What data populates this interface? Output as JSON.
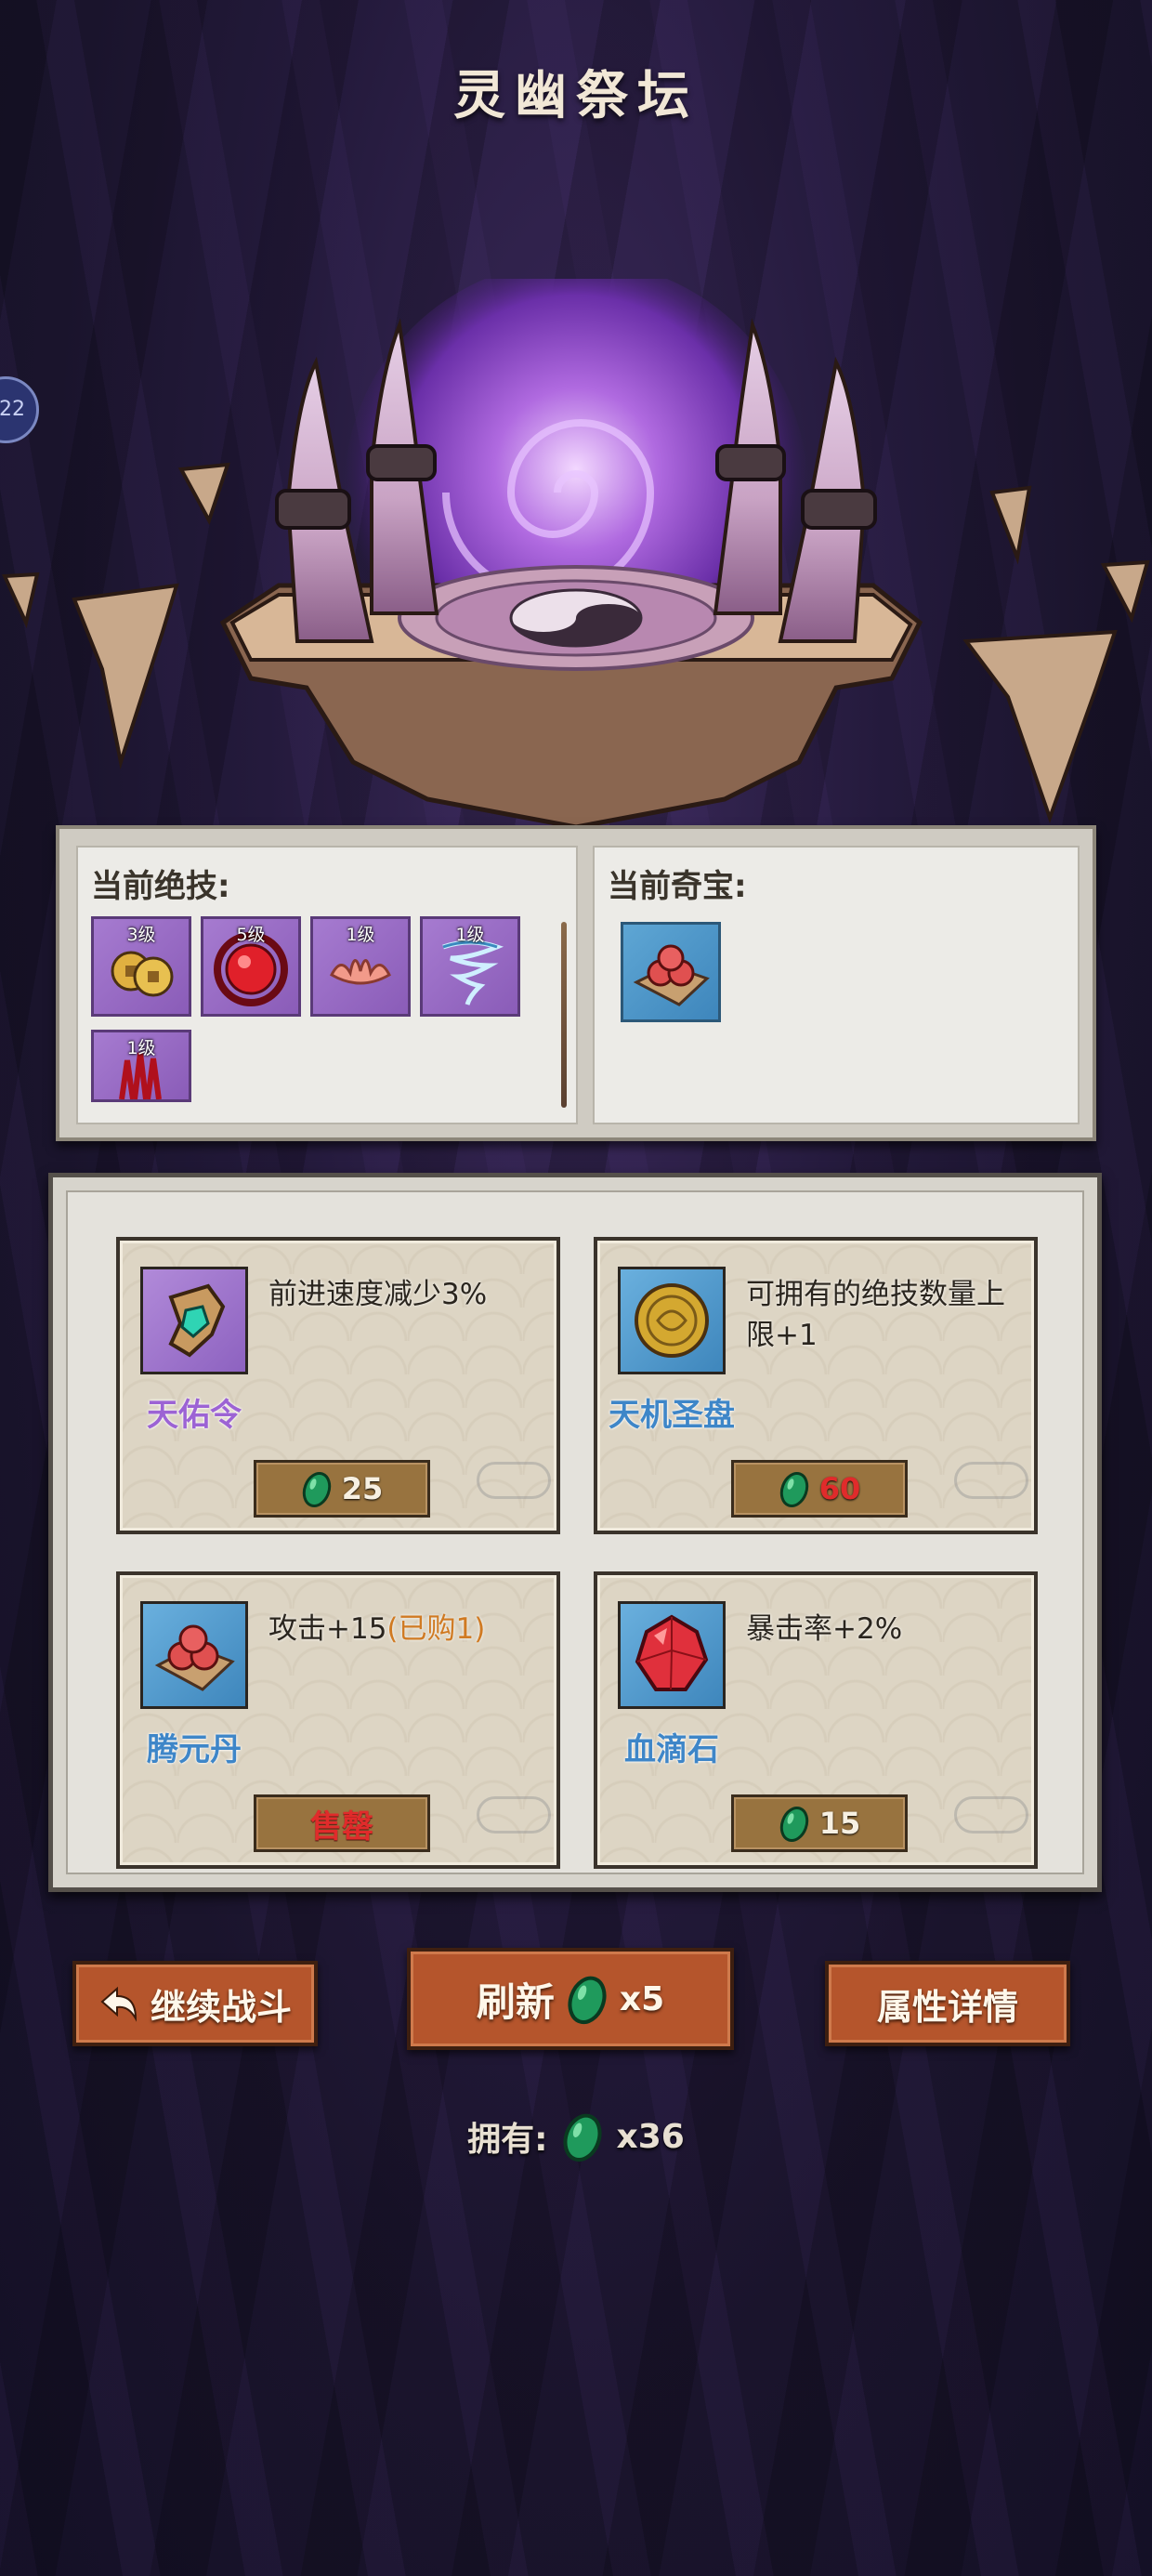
{
  "title": "灵幽祭坛",
  "side_badge": "22",
  "equipped": {
    "skills_label": "当前绝技:",
    "skills": [
      {
        "level": "3级",
        "icon": "coins-icon"
      },
      {
        "level": "5级",
        "icon": "red-orb-icon"
      },
      {
        "level": "1级",
        "icon": "lotus-icon"
      },
      {
        "level": "1级",
        "icon": "whirlwind-icon"
      },
      {
        "level": "1级",
        "icon": "blood-claw-icon"
      }
    ],
    "treasures_label": "当前奇宝:",
    "treasures": [
      {
        "icon": "pills-plate-icon"
      }
    ]
  },
  "shop": {
    "items": [
      {
        "name": "天佑令",
        "desc": "前进速度减少3%",
        "price": "25",
        "icon": "talisman-icon",
        "rarity": "purple"
      },
      {
        "name": "天机圣盘",
        "desc": "可拥有的绝技数量上限+1",
        "price": "60",
        "price_color": "#e02b2b",
        "icon": "golden-disc-icon",
        "rarity": "blue"
      },
      {
        "name": "腾元丹",
        "desc": "攻击+15",
        "bought_note": "(已购1)",
        "sold_label": "售罄",
        "icon": "pills-plate-icon",
        "rarity": "blue"
      },
      {
        "name": "血滴石",
        "desc": "暴击率+2%",
        "price": "15",
        "icon": "blood-gem-icon",
        "rarity": "blue"
      }
    ]
  },
  "buttons": {
    "continue": "继续战斗",
    "refresh": "刷新",
    "refresh_cost": "x5",
    "detail": "属性详情"
  },
  "owned": {
    "label": "拥有:",
    "count": "x36"
  },
  "colors": {
    "currency": "#1f9a5c",
    "button": "#b5552c",
    "price_button": "#98733f"
  }
}
